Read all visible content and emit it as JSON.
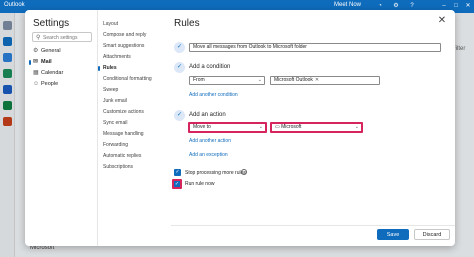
{
  "app": {
    "brand": "Outlook",
    "meet_now": "Meet Now"
  },
  "background": {
    "filter_text": "Filter",
    "footer_item": "Microsoft"
  },
  "settings": {
    "title": "Settings",
    "search_placeholder": "Search settings",
    "categories": [
      {
        "label": "General",
        "icon": "gear-icon",
        "glyph": "⚙"
      },
      {
        "label": "Mail",
        "icon": "mail-icon",
        "glyph": "✉",
        "active": true
      },
      {
        "label": "Calendar",
        "icon": "calendar-icon",
        "glyph": "▦"
      },
      {
        "label": "People",
        "icon": "people-icon",
        "glyph": "☺"
      }
    ],
    "mail_items": [
      "Layout",
      "Compose and reply",
      "Smart suggestions",
      "Attachments",
      "Rules",
      "Conditional formatting",
      "Sweep",
      "Junk email",
      "Customize actions",
      "Sync email",
      "Message handling",
      "Forwarding",
      "Automatic replies",
      "Subscriptions"
    ],
    "active_mail_item": "Rules"
  },
  "rules": {
    "title": "Rules",
    "rule_name": "Move all messages from Outlook to Microsoft folder",
    "condition": {
      "label": "Add a condition",
      "field": "From",
      "value_tag": "Microsoft Outlook",
      "add_link": "Add another condition"
    },
    "action": {
      "label": "Add an action",
      "field": "Move to",
      "folder": "Microsoft",
      "add_action_link": "Add another action",
      "add_exception_link": "Add an exception"
    },
    "stop_processing_label": "Stop processing more rules",
    "run_rule_now_label": "Run rule now",
    "save_label": "Save",
    "discard_label": "Discard"
  },
  "colors": {
    "accent": "#0f6cbd",
    "highlight": "#d6245c"
  }
}
